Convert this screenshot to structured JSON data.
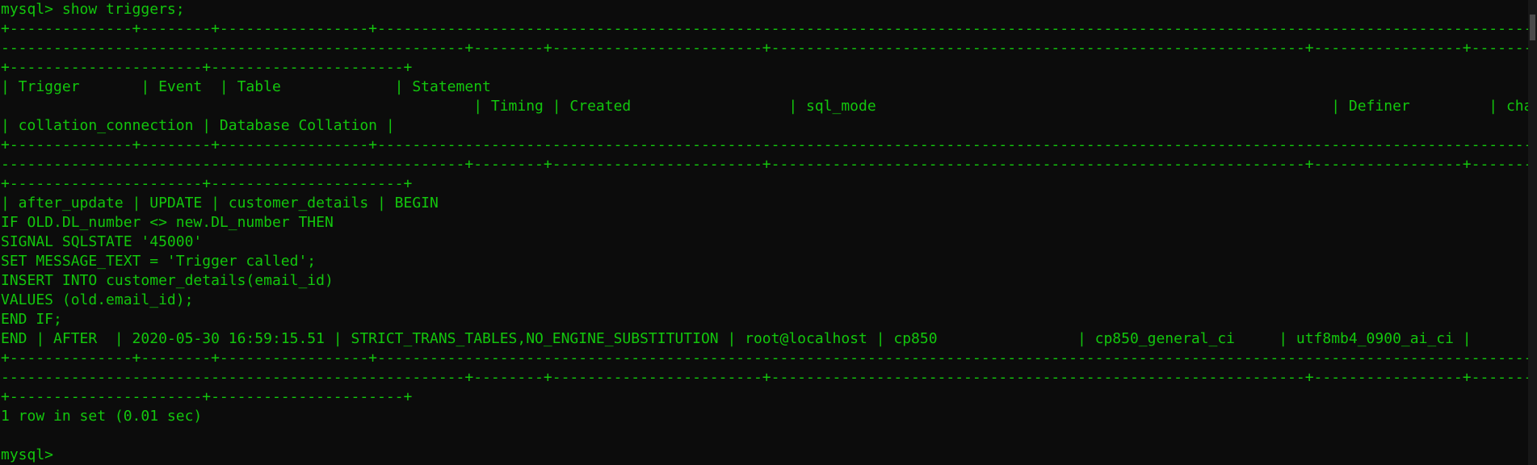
{
  "terminal": {
    "lines": [
      "mysql> show triggers;",
      "+--------------+--------+-----------------+-------------------------------------------------------------------------------------------------------------------------------------------------",
      "-----------------------------------------------------+--------+------------------------+-------------------------------------------------------------+-----------------+---------------",
      "+----------------------+----------------------+",
      "| Trigger       | Event  | Table             | Statement",
      "                                                      | Timing | Created                  | sql_mode                                                    | Definer         | character_set_client",
      "| collation_connection | Database Collation |",
      "+--------------+--------+-----------------+-------------------------------------------------------------------------------------------------------------------------------------------------",
      "-----------------------------------------------------+--------+------------------------+-------------------------------------------------------------+-----------------+---------------",
      "+----------------------+----------------------+",
      "| after_update | UPDATE | customer_details | BEGIN",
      "IF OLD.DL_number <> new.DL_number THEN",
      "SIGNAL SQLSTATE '45000'",
      "SET MESSAGE_TEXT = 'Trigger called';",
      "INSERT INTO customer_details(email_id)",
      "VALUES (old.email_id);",
      "END IF;",
      "END | AFTER  | 2020-05-30 16:59:15.51 | STRICT_TRANS_TABLES,NO_ENGINE_SUBSTITUTION | root@localhost | cp850                | cp850_general_ci     | utf8mb4_0900_ai_ci |",
      "+--------------+--------+-----------------+-------------------------------------------------------------------------------------------------------------------------------------------------",
      "-----------------------------------------------------+--------+------------------------+-------------------------------------------------------------+-----------------+---------------",
      "+----------------------+----------------------+",
      "1 row in set (0.01 sec)",
      "",
      "mysql>"
    ]
  },
  "colors": {
    "background": "#0c0c0c",
    "text": "#13c60d"
  }
}
